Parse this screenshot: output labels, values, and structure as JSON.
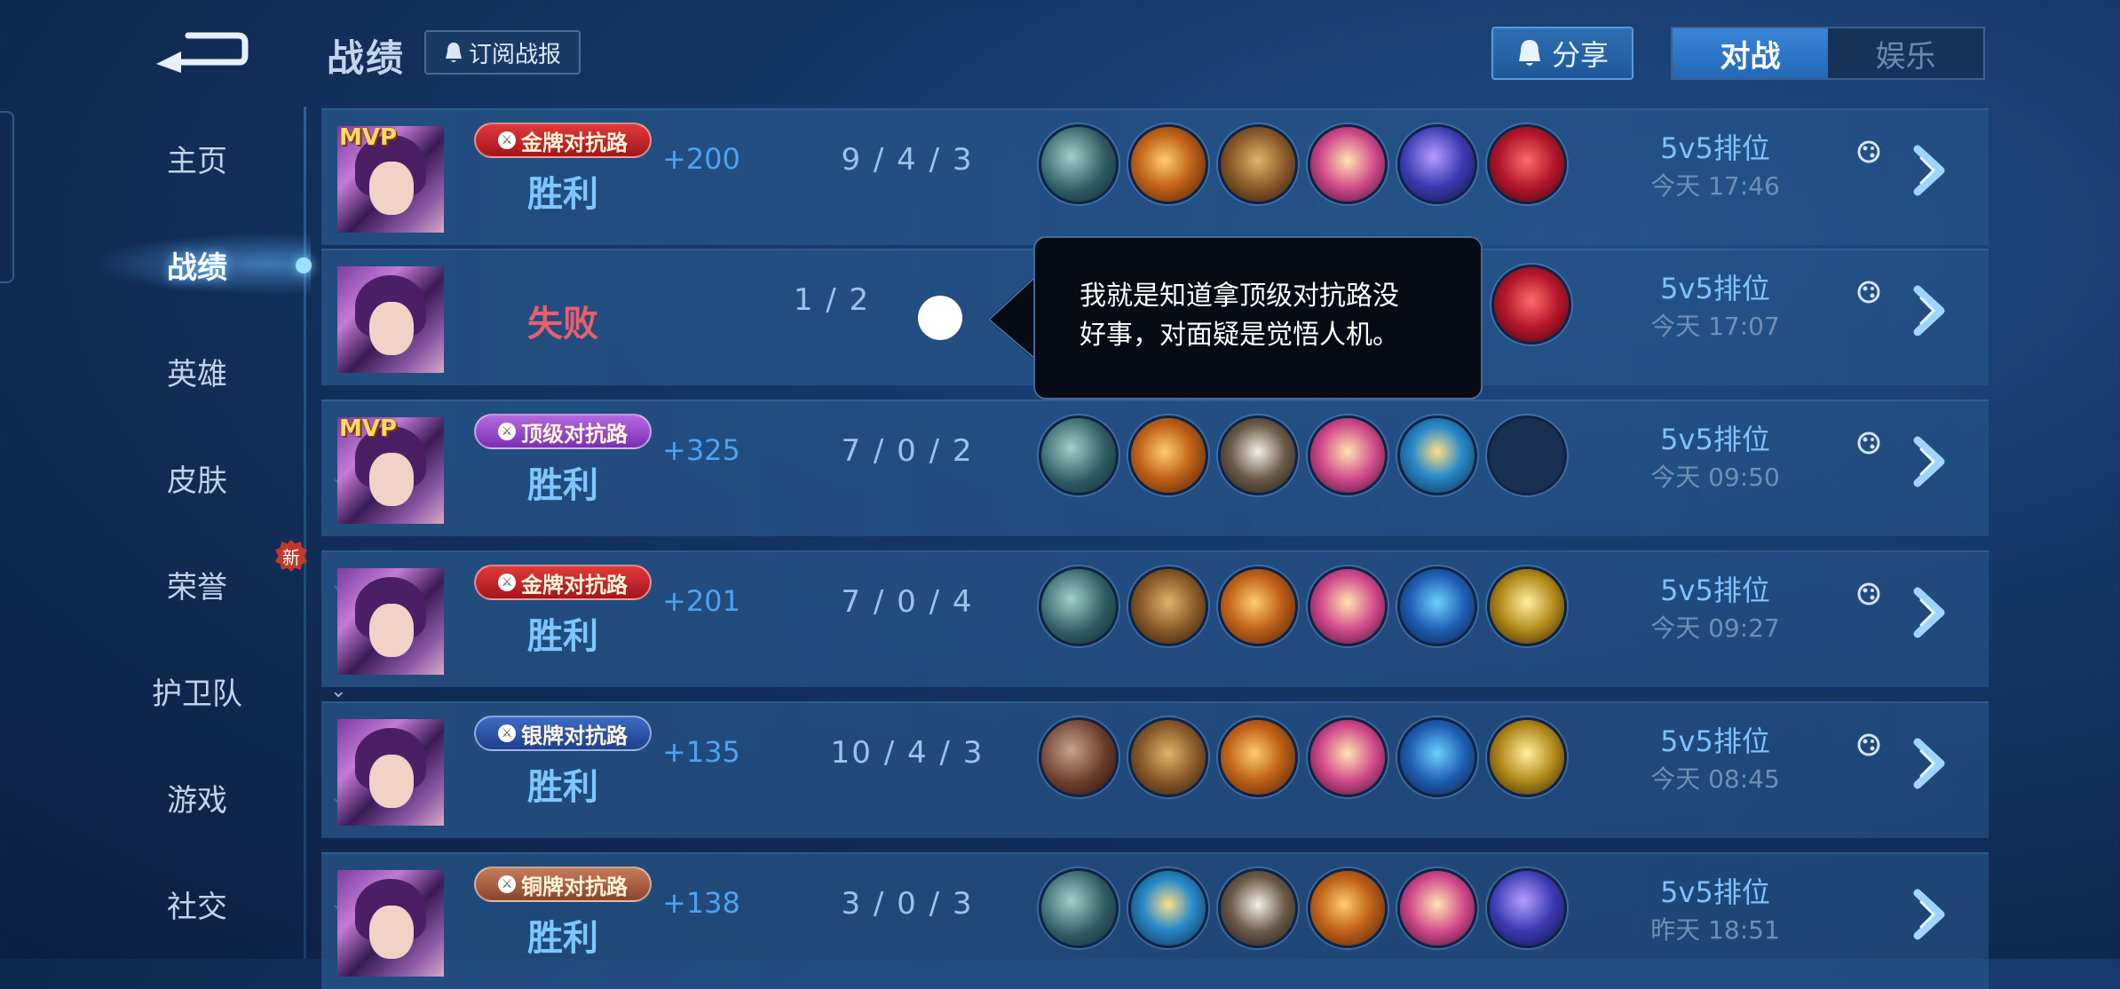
{
  "header": {
    "title": "战绩",
    "subscribe_label": "订阅战报",
    "share_label": "分享",
    "mode_tabs": [
      {
        "label": "对战",
        "active": true
      },
      {
        "label": "娱乐",
        "active": false
      }
    ]
  },
  "sidebar": {
    "items": [
      {
        "label": "主页",
        "chevron": false,
        "active": false
      },
      {
        "label": "战绩",
        "chevron": false,
        "active": true
      },
      {
        "label": "英雄",
        "chevron": false,
        "active": false
      },
      {
        "label": "皮肤",
        "chevron": true,
        "active": false
      },
      {
        "label": "荣誉",
        "chevron": true,
        "active": false,
        "badge": "新"
      },
      {
        "label": "护卫队",
        "chevron": true,
        "active": false
      },
      {
        "label": "游戏",
        "chevron": true,
        "active": false
      },
      {
        "label": "社交",
        "chevron": true,
        "active": false
      }
    ]
  },
  "matches": [
    {
      "mvp": "MVP",
      "rank": "金牌对抗路",
      "result": "胜利",
      "score": "+200",
      "kda": "9 / 4 / 3",
      "items": [
        "it-boots",
        "it-sword",
        "it-armor",
        "it-book",
        "it-staff",
        "it-red"
      ],
      "mode": "5v5排位",
      "time": "今天 17:46"
    },
    {
      "mvp": "",
      "rank": "",
      "result": "失败",
      "score": "",
      "kda": "1 / 2",
      "items": [
        "it-red"
      ],
      "mode": "5v5排位",
      "time": "今天 17:07"
    },
    {
      "mvp": "MVP",
      "rank": "顶级对抗路",
      "result": "胜利",
      "score": "+325",
      "kda": "7 / 0 / 2",
      "items": [
        "it-boots",
        "it-sword",
        "it-bottle",
        "it-book",
        "it-orb",
        "it-empty"
      ],
      "mode": "5v5排位",
      "time": "今天 09:50"
    },
    {
      "mvp": "",
      "rank": "金牌对抗路",
      "result": "胜利",
      "score": "+201",
      "kda": "7 / 0 / 4",
      "items": [
        "it-boots",
        "it-armor",
        "it-sword",
        "it-book",
        "it-wing",
        "it-claw"
      ],
      "mode": "5v5排位",
      "time": "今天 09:27"
    },
    {
      "mvp": "",
      "rank": "银牌对抗路",
      "result": "胜利",
      "score": "+135",
      "kda": "10 / 4 / 3",
      "items": [
        "it-boots2",
        "it-armor",
        "it-sword",
        "it-book",
        "it-wing",
        "it-claw"
      ],
      "mode": "5v5排位",
      "time": "今天 08:45"
    },
    {
      "mvp": "",
      "rank": "铜牌对抗路",
      "result": "胜利",
      "score": "+138",
      "kda": "3 / 0 / 3",
      "items": [
        "it-boots",
        "it-orb",
        "it-bottle",
        "it-sword",
        "it-book",
        "it-staff"
      ],
      "mode": "5v5排位",
      "time": "昨天 18:51"
    }
  ],
  "tooltip": {
    "text_line1": "我就是知道拿顶级对抗路没",
    "text_line2": "好事，对面疑是觉悟人机。"
  },
  "colors": {
    "win": "#7dc6ff",
    "loss": "#ea5f6e",
    "score": "#4da3f0",
    "gold_badge": "#c8232a",
    "top_badge": "#9a4fd0",
    "silver_badge": "#2f58b0",
    "bronze_badge": "#a85e42"
  }
}
